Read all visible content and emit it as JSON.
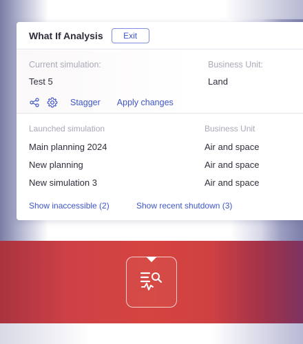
{
  "dialog": {
    "title": "What If Analysis",
    "exit_label": "Exit"
  },
  "current": {
    "simulation_label": "Current simulation:",
    "simulation_value": "Test 5",
    "business_unit_label": "Business Unit:",
    "business_unit_value": "Land",
    "actions": {
      "share_icon": "share-icon",
      "settings_icon": "gear-icon",
      "stagger_label": "Stagger",
      "apply_label": "Apply changes"
    }
  },
  "launched": {
    "headers": [
      "Launched simulation",
      "Business Unit"
    ],
    "rows": [
      {
        "simulation": "Main planning 2024",
        "unit": "Air and space"
      },
      {
        "simulation": "New planning",
        "unit": "Air and space"
      },
      {
        "simulation": "New simulation 3",
        "unit": "Air and space"
      }
    ],
    "show_inaccessible": "Show inaccessible (2)",
    "show_recent_shutdown": "Show recent shutdown (3)"
  },
  "app_icon": "analysis-search-icon",
  "colors": {
    "accent": "#3e55c8",
    "band": "#d5443f",
    "muted_text": "#a9a9b8"
  }
}
